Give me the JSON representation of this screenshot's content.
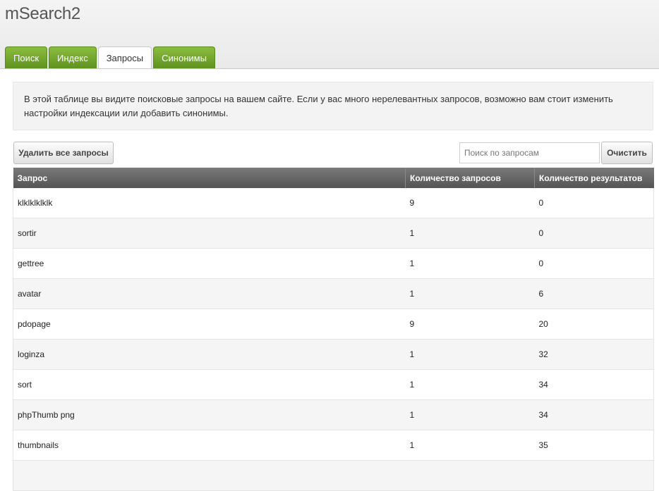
{
  "app": {
    "title": "mSearch2"
  },
  "tabs": [
    {
      "label": "Поиск",
      "active": false
    },
    {
      "label": "Индекс",
      "active": false
    },
    {
      "label": "Запросы",
      "active": true
    },
    {
      "label": "Синонимы",
      "active": false
    }
  ],
  "info": {
    "text": "В этой таблице вы видите поисковые запросы на вашем сайте. Если у вас много нерелевантных запросов, возможно вам стоит изменить настройки индексации или добавить синонимы."
  },
  "toolbar": {
    "delete_all_label": "Удалить все запросы",
    "search_placeholder": "Поиск по запросам",
    "search_value": "",
    "clear_label": "Очистить"
  },
  "table": {
    "columns": [
      "Запрос",
      "Количество запросов",
      "Количество результатов"
    ],
    "rows": [
      [
        "klklklklklk",
        "9",
        "0"
      ],
      [
        "sortir",
        "1",
        "0"
      ],
      [
        "gettree",
        "1",
        "0"
      ],
      [
        "avatar",
        "1",
        "6"
      ],
      [
        "pdopage",
        "9",
        "20"
      ],
      [
        "loginza",
        "1",
        "32"
      ],
      [
        "sort",
        "1",
        "34"
      ],
      [
        "phpThumb png",
        "1",
        "34"
      ],
      [
        "thumbnails",
        "1",
        "35"
      ],
      [
        "",
        "",
        ""
      ]
    ]
  },
  "colors": {
    "tab_green": "#6fa32b",
    "header_gray": "#636363",
    "info_bg": "#f3f3f3"
  }
}
